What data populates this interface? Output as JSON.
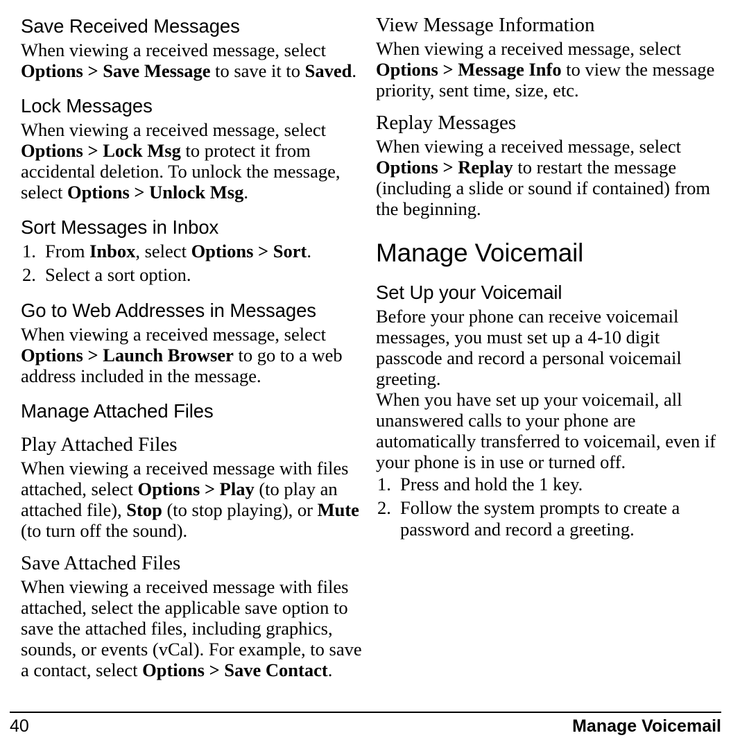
{
  "page": {
    "number": "40",
    "footer_section": "Manage Voicemail"
  },
  "left_column": {
    "sections": [
      {
        "heading": "Save Received Messages",
        "heading_style": "h2-sans",
        "paragraphs": [
          {
            "runs": [
              {
                "text": "When viewing a received message, select ",
                "bold": false
              },
              {
                "text": "Options > Save Message",
                "bold": true
              },
              {
                "text": " to save it to ",
                "bold": false
              },
              {
                "text": "Saved",
                "bold": true
              },
              {
                "text": ".",
                "bold": false
              }
            ]
          }
        ]
      },
      {
        "heading": "Lock Messages",
        "heading_style": "h2-sans",
        "paragraphs": [
          {
            "runs": [
              {
                "text": "When viewing a received message, select ",
                "bold": false
              },
              {
                "text": "Options > Lock Msg",
                "bold": true
              },
              {
                "text": " to protect it from accidental deletion. To unlock the message, select ",
                "bold": false
              },
              {
                "text": "Options > Unlock Msg",
                "bold": true
              },
              {
                "text": ".",
                "bold": false
              }
            ]
          }
        ]
      },
      {
        "heading": "Sort Messages in Inbox",
        "heading_style": "h2-sans",
        "steps": [
          {
            "runs": [
              {
                "text": "From ",
                "bold": false
              },
              {
                "text": "Inbox",
                "bold": true
              },
              {
                "text": ", select ",
                "bold": false
              },
              {
                "text": "Options > Sort",
                "bold": true
              },
              {
                "text": ".",
                "bold": false
              }
            ]
          },
          {
            "runs": [
              {
                "text": "Select a sort option.",
                "bold": false
              }
            ]
          }
        ]
      },
      {
        "heading": "Go to Web Addresses in Messages",
        "heading_style": "h2-sans",
        "paragraphs": [
          {
            "runs": [
              {
                "text": "When viewing a received message, select ",
                "bold": false
              },
              {
                "text": "Options > Launch Browser",
                "bold": true
              },
              {
                "text": " to go to a web address included in the message.",
                "bold": false
              }
            ]
          }
        ]
      },
      {
        "heading": "Manage Attached Files",
        "heading_style": "h2-sans",
        "paragraphs": []
      },
      {
        "heading": "Play Attached Files",
        "heading_style": "h3-serif",
        "paragraphs": [
          {
            "runs": [
              {
                "text": "When viewing a received message with files attached, select ",
                "bold": false
              },
              {
                "text": "Options > Play",
                "bold": true
              },
              {
                "text": " (to play an attached file), ",
                "bold": false
              },
              {
                "text": "Stop",
                "bold": true
              },
              {
                "text": " (to stop playing), or ",
                "bold": false
              },
              {
                "text": "Mute",
                "bold": true
              },
              {
                "text": " (to turn off the sound).",
                "bold": false
              }
            ]
          }
        ]
      },
      {
        "heading": "Save Attached Files",
        "heading_style": "h3-serif",
        "paragraphs": [
          {
            "runs": [
              {
                "text": "When viewing a received message with files attached, select the applicable save option to save the attached files, including graphics, sounds, or events (vCal). For example, to save a contact, select ",
                "bold": false
              },
              {
                "text": "Options > Save Contact",
                "bold": true
              },
              {
                "text": ".",
                "bold": false
              }
            ]
          }
        ]
      }
    ]
  },
  "right_column": {
    "sections": [
      {
        "heading": "View Message Information",
        "heading_style": "h3-serif",
        "paragraphs": [
          {
            "runs": [
              {
                "text": "When viewing a received message, select ",
                "bold": false
              },
              {
                "text": "Options > Message Info",
                "bold": true
              },
              {
                "text": " to view the message priority, sent time, size, etc.",
                "bold": false
              }
            ]
          }
        ]
      },
      {
        "heading": "Replay Messages",
        "heading_style": "h3-serif",
        "paragraphs": [
          {
            "runs": [
              {
                "text": "When viewing a received message, select ",
                "bold": false
              },
              {
                "text": "Options > Replay",
                "bold": true
              },
              {
                "text": " to restart the message (including a slide or sound if contained) from the beginning.",
                "bold": false
              }
            ]
          }
        ]
      },
      {
        "heading": "Manage Voicemail",
        "heading_style": "h1-chapter",
        "paragraphs": []
      },
      {
        "heading": "Set Up your Voicemail",
        "heading_style": "h2-sans",
        "paragraphs": [
          {
            "runs": [
              {
                "text": "Before your phone can receive voicemail messages, you must set up a 4-10 digit passcode and record a personal voicemail greeting.",
                "bold": false
              }
            ]
          },
          {
            "runs": [
              {
                "text": "When you have set up your voicemail, all unanswered calls to your phone are automatically transferred to voicemail, even if your phone is in use or turned off.",
                "bold": false
              }
            ]
          }
        ],
        "steps": [
          {
            "runs": [
              {
                "text": "Press and hold the 1 key.",
                "bold": false
              }
            ]
          },
          {
            "runs": [
              {
                "text": "Follow the system prompts to create a password and record a greeting.",
                "bold": false
              }
            ]
          }
        ]
      }
    ]
  }
}
